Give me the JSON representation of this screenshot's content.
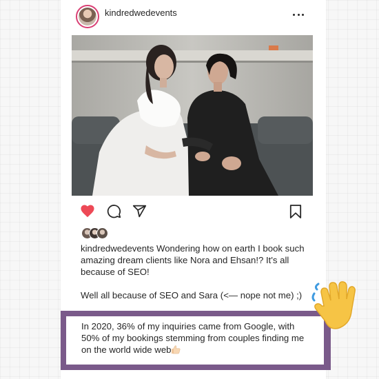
{
  "post": {
    "username": "kindredwedevents",
    "caption": {
      "user": "kindredwedevents",
      "text": "Wondering how on earth I book such amazing dream clients like Nora and Ehsan!? It's all because of SEO!",
      "para2": "Well all because of SEO and Sara (<— nope not me) ;)"
    },
    "highlight": {
      "text": "In 2020, 36% of my inquiries came from Google, with 50% of my bookings stemming from couples finding me on the world wide web"
    },
    "liked": true
  },
  "icons": {
    "more": "more-dots-icon",
    "like": "heart-icon",
    "comment": "comment-icon",
    "share": "paper-plane-icon",
    "save": "bookmark-icon",
    "thumbs_up": "thumbs-up-emoji",
    "wave": "waving-hand-emoji"
  },
  "colors": {
    "heart": "#ed4956",
    "avatar_ring": "#d93f74",
    "highlight_border": "#7a5a8a",
    "wave": "#f6c445"
  }
}
